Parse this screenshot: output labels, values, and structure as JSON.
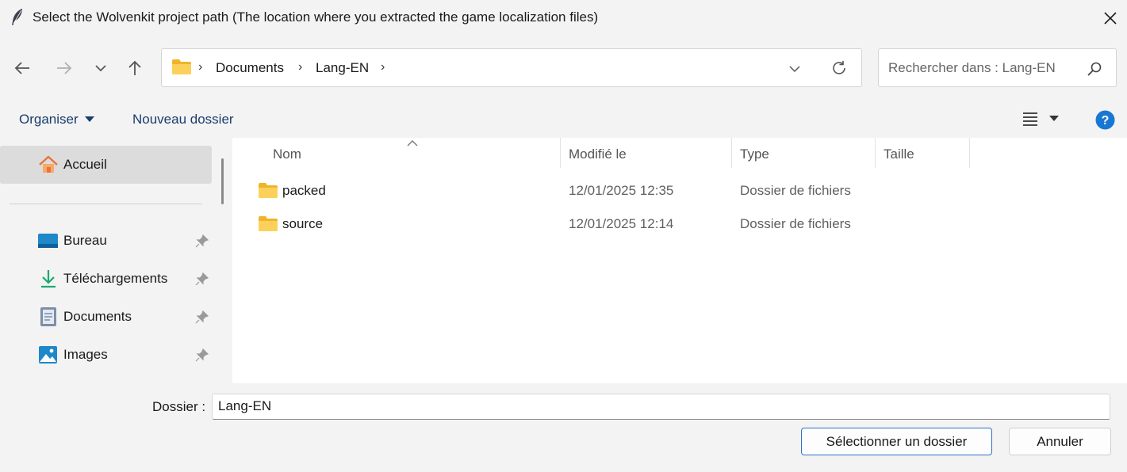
{
  "window": {
    "title": "Select the Wolvenkit project path (The location where you extracted the game localization files)",
    "title_icon": "feather-icon",
    "close_icon": "close-icon"
  },
  "nav": {
    "back_icon": "arrow-left-icon",
    "forward_icon": "arrow-right-icon",
    "recent_icon": "chevron-down-icon",
    "up_icon": "arrow-up-icon",
    "breadcrumb": [
      "Documents",
      "Lang-EN"
    ],
    "refresh_icon": "refresh-icon",
    "search_placeholder": "Rechercher dans : Lang-EN"
  },
  "toolbar": {
    "organize_label": "Organiser",
    "new_folder_label": "Nouveau dossier",
    "view_icon": "list-view-icon",
    "help_icon": "help-icon"
  },
  "sidebar": {
    "home_label": "Accueil",
    "items": [
      {
        "label": "Bureau",
        "icon": "desktop-icon",
        "pinned": true
      },
      {
        "label": "Téléchargements",
        "icon": "download-icon",
        "pinned": true
      },
      {
        "label": "Documents",
        "icon": "documents-icon",
        "pinned": true
      },
      {
        "label": "Images",
        "icon": "images-icon",
        "pinned": true
      }
    ]
  },
  "filelist": {
    "columns": [
      "Nom",
      "Modifié le",
      "Type",
      "Taille"
    ],
    "rows": [
      {
        "name": "packed",
        "modified": "12/01/2025 12:35",
        "type": "Dossier de fichiers",
        "size": ""
      },
      {
        "name": "source",
        "modified": "12/01/2025 12:14",
        "type": "Dossier de fichiers",
        "size": ""
      }
    ]
  },
  "footer": {
    "folder_label": "Dossier :",
    "folder_value": "Lang-EN",
    "select_label": "Sélectionner un dossier",
    "cancel_label": "Annuler"
  },
  "colors": {
    "accent": "#2f6fc4",
    "folder_yellow": "#f6c343",
    "help_blue": "#1877d2",
    "chrome_bg": "#f3f3f3"
  }
}
